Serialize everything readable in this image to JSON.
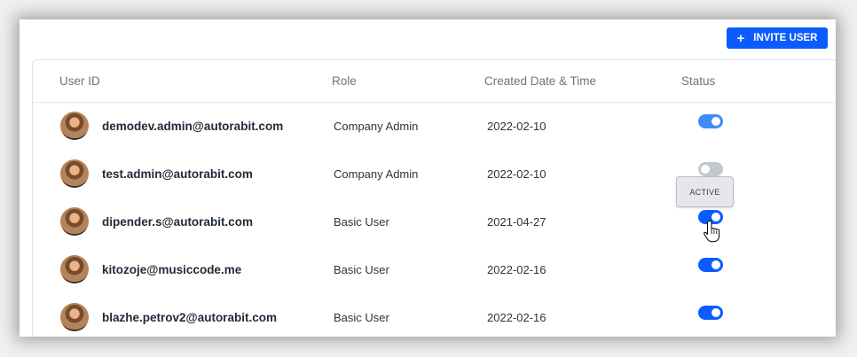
{
  "toolbar": {
    "invite_label": "INVITE USER",
    "invite_icon": "plus-icon"
  },
  "table": {
    "headers": [
      "User ID",
      "Role",
      "Created Date & Time",
      "Status"
    ],
    "rows": [
      {
        "email": "demodev.admin@autorabit.com",
        "role": "Company Admin",
        "date": "2022-02-10",
        "status": "on"
      },
      {
        "email": "test.admin@autorabit.com",
        "role": "Company Admin",
        "date": "2022-02-10",
        "status": "off"
      },
      {
        "email": "dipender.s@autorabit.com",
        "role": "Basic User",
        "date": "2021-04-27",
        "status": "on"
      },
      {
        "email": "kitozoje@musiccode.me",
        "role": "Basic User",
        "date": "2022-02-16",
        "status": "on"
      },
      {
        "email": "blazhe.petrov2@autorabit.com",
        "role": "Basic User",
        "date": "2022-02-16",
        "status": "on"
      }
    ]
  },
  "tooltip": {
    "text": "ACTIVE"
  },
  "colors": {
    "accent": "#0b5cff",
    "toggle_off": "#c4c7cc"
  }
}
